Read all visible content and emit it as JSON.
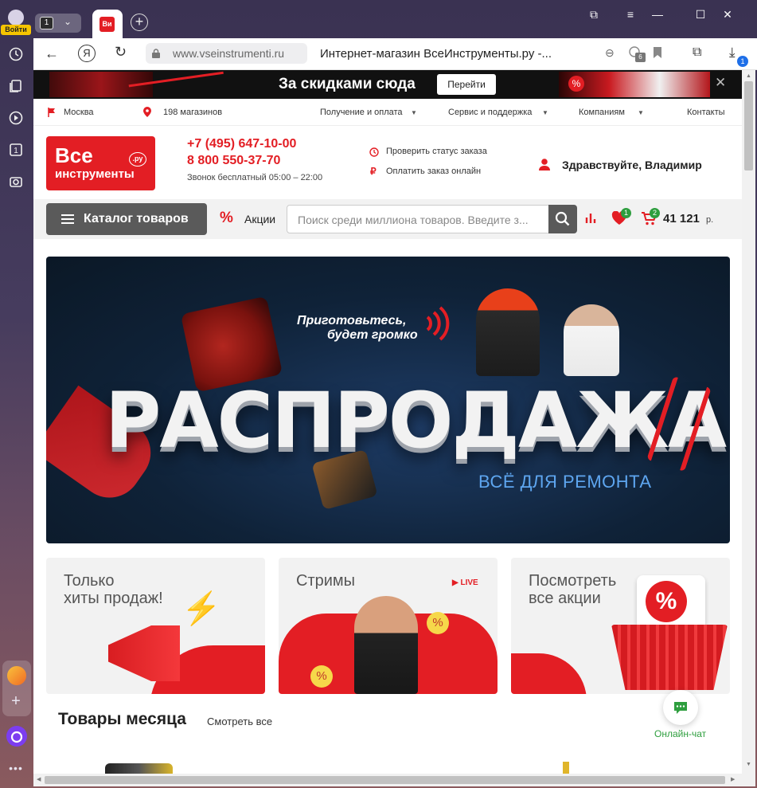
{
  "browser": {
    "login_label": "Войти",
    "tab_count": "1",
    "tab_favicon": "Ви",
    "url": "www.vseinstrumenti.ru",
    "page_title": "Интернет-магазин ВсеИнструменты.ру -...",
    "tab_badge_count": "6",
    "downloads_badge": "1"
  },
  "promo": {
    "text": "За скидками сюда",
    "button": "Перейти"
  },
  "topnav": {
    "city": "Москва",
    "stores": "198 магазинов",
    "delivery": "Получение и оплата",
    "service": "Сервис и поддержка",
    "companies": "Компаниям",
    "contacts": "Контакты"
  },
  "header": {
    "logo_line1": "Все",
    "logo_line2": "инструменты",
    "logo_ru": ".ру",
    "phone1": "+7 (495) 647-10-00",
    "phone2": "8 800 550-37-70",
    "call_hours": "Звонок бесплатный 05:00 – 22:00",
    "check_status": "Проверить статус заказа",
    "pay_online": "Оплатить заказ онлайн",
    "greeting": "Здравствуйте, Владимир"
  },
  "catbar": {
    "catalog": "Каталог товаров",
    "promos": "Акции",
    "search_placeholder": "Поиск среди миллиона товаров. Введите з...",
    "favorites_count": "1",
    "cart_count": "2",
    "cart_total": "41 121",
    "currency": "р."
  },
  "banner": {
    "tagline1": "Приготовьтесь,",
    "tagline2": "будет громко",
    "headline": "РАСПРОДАЖА",
    "subline": "ВСЁ ДЛЯ РЕМОНТА"
  },
  "cards": [
    {
      "title": "Только\nхиты продаж!"
    },
    {
      "title": "Стримы",
      "badge": "LIVE"
    },
    {
      "title": "Посмотреть\nвсе акции"
    }
  ],
  "month": {
    "title": "Товары месяца",
    "see_all": "Смотреть все"
  },
  "chat": {
    "label": "Онлайн-чат"
  },
  "colors": {
    "brand_red": "#e31e24",
    "dark_gray": "#5a5a5a",
    "chat_green": "#2e9e3e"
  }
}
